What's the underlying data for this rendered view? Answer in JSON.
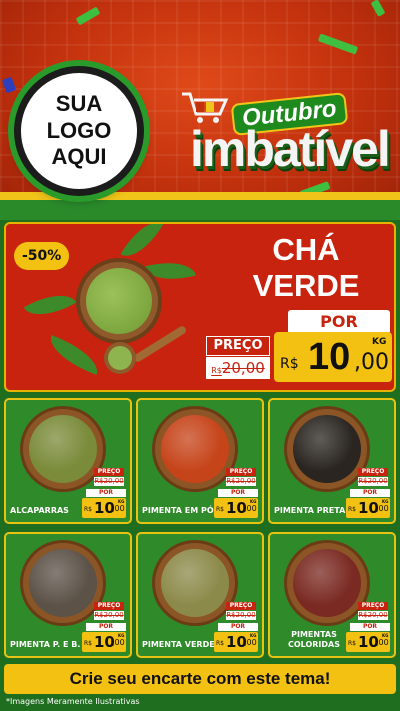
{
  "header": {
    "logo_lines": [
      "SUA",
      "LOGO",
      "AQUI"
    ],
    "title_top": "Outubro",
    "title_main": "imbatível"
  },
  "feature": {
    "discount": "-50%",
    "name_lines": [
      "CHÁ",
      "VERDE"
    ],
    "preco_label": "PREÇO",
    "old_currency": "R$",
    "old_price": "20,00",
    "por_label": "POR",
    "currency": "R$",
    "price_int": "10",
    "price_cents": ",00",
    "unit": "KG"
  },
  "products": [
    {
      "name": "ALCAPARRAS",
      "preco": "PREÇO",
      "old": "R$20,00",
      "por": "POR",
      "cur": "R$",
      "int": "10",
      "cents": ",00",
      "unit": "KG",
      "color": "#7a8b3a"
    },
    {
      "name": "PIMENTA EM PÓ",
      "preco": "PREÇO",
      "old": "R$20,00",
      "por": "POR",
      "cur": "R$",
      "int": "10",
      "cents": ",00",
      "unit": "KG",
      "color": "#c6441a"
    },
    {
      "name": "PIMENTA PRETA",
      "preco": "PREÇO",
      "old": "R$20,00",
      "por": "POR",
      "cur": "R$",
      "int": "10",
      "cents": ",00",
      "unit": "KG",
      "color": "#2a2520"
    },
    {
      "name": "PIMENTA P. E B.",
      "preco": "PREÇO",
      "old": "R$20,00",
      "por": "POR",
      "cur": "R$",
      "int": "10",
      "cents": ",00",
      "unit": "KG",
      "color": "#5c5248"
    },
    {
      "name": "PIMENTA VERDE",
      "preco": "PREÇO",
      "old": "R$20,00",
      "por": "POR",
      "cur": "R$",
      "int": "10",
      "cents": ",00",
      "unit": "KG",
      "color": "#8c8a4a"
    },
    {
      "name": "PIMENTAS COLORIDAS",
      "preco": "PREÇO",
      "old": "R$20,00",
      "por": "POR",
      "cur": "R$",
      "int": "10",
      "cents": ",00",
      "unit": "KG",
      "color": "#7a2a22"
    }
  ],
  "footer": {
    "cta": "Crie seu encarte com este tema!",
    "disclaimer": "*Imagens Meramente Ilustrativas"
  }
}
